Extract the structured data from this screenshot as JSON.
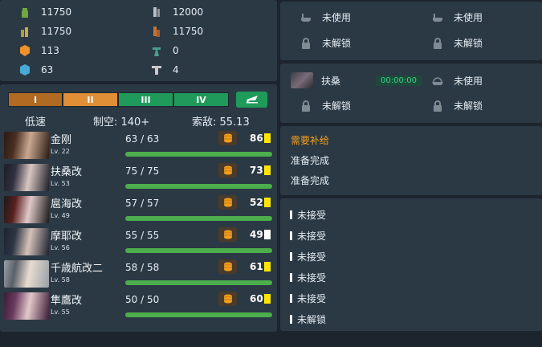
{
  "resources": [
    {
      "icon": "fuel-icon",
      "value": "11750"
    },
    {
      "icon": "steel-icon",
      "value": "12000"
    },
    {
      "icon": "ammo-icon",
      "value": "11750"
    },
    {
      "icon": "bauxite-icon",
      "value": "11750"
    },
    {
      "icon": "instant-repair-icon",
      "value": "113"
    },
    {
      "icon": "development-material-icon",
      "value": "0"
    },
    {
      "icon": "instant-construction-icon",
      "value": "63"
    },
    {
      "icon": "improvement-material-icon",
      "value": "4"
    }
  ],
  "docks": {
    "repair": [
      {
        "status": "未使用",
        "icon": "bathtub-icon"
      },
      {
        "status": "未使用",
        "icon": "bathtub-icon"
      },
      {
        "status": "未解锁",
        "icon": "lock-icon"
      },
      {
        "status": "未解锁",
        "icon": "lock-icon"
      }
    ],
    "construction": [
      {
        "ship": "扶桑",
        "timer": "00:00:00"
      },
      {
        "status": "未使用"
      },
      {
        "status": "未解锁"
      },
      {
        "status": "未解锁"
      }
    ]
  },
  "fleet": {
    "tabs": [
      {
        "label": "I",
        "color": "#b06a22"
      },
      {
        "label": "II",
        "color": "#e08f36"
      },
      {
        "label": "III",
        "color": "#1f9a5a"
      },
      {
        "label": "IV",
        "color": "#1f9a5a"
      }
    ],
    "speed": "低速",
    "air": "制空: 140+",
    "los": "索敌: 55.13",
    "ships": [
      {
        "name": "金刚",
        "lv": "Lv. 22",
        "hp": "63 / 63",
        "cond": "86",
        "cond_color": "#ffe600"
      },
      {
        "name": "扶桑改",
        "lv": "Lv. 53",
        "hp": "75 / 75",
        "cond": "73",
        "cond_color": "#ffe600"
      },
      {
        "name": "扈海改",
        "lv": "Lv. 49",
        "hp": "57 / 57",
        "cond": "52",
        "cond_color": "#ffe600"
      },
      {
        "name": "摩耶改",
        "lv": "Lv. 56",
        "hp": "55 / 55",
        "cond": "49",
        "cond_color": "#ffffff"
      },
      {
        "name": "千歳航改二",
        "lv": "Lv. 58",
        "hp": "58 / 58",
        "cond": "61",
        "cond_color": "#ffe600"
      },
      {
        "name": "隼鷹改",
        "lv": "Lv. 55",
        "hp": "50 / 50",
        "cond": "60",
        "cond_color": "#ffe600"
      }
    ]
  },
  "fleet_status": [
    "需要补给",
    "准备完成",
    "准备完成"
  ],
  "quests": [
    "未接受",
    "未接受",
    "未接受",
    "未接受",
    "未接受",
    "未解锁"
  ]
}
